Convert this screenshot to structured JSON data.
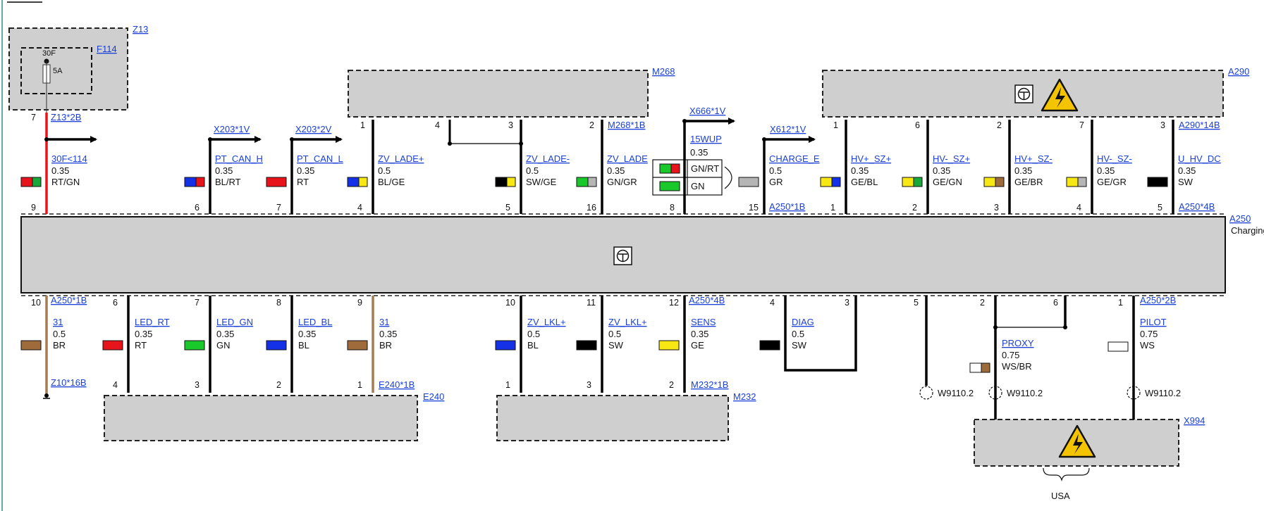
{
  "z13": {
    "id": "Z13",
    "fuse_id": "F114",
    "fuse_terminal": "30F",
    "fuse_rating": "5A",
    "conn": "Z13*2B",
    "pin": "7"
  },
  "m268": {
    "id": "M268",
    "conn": "M268*1B"
  },
  "a290": {
    "id": "A290",
    "conn": "A290*14B"
  },
  "a250": {
    "id": "A250",
    "desc": "Charging",
    "conn_top_left": "A250*1B",
    "conn_top_right": "A250*4B",
    "conn_bot_left": "A250*1B",
    "conn_bot_mid": "A250*4B",
    "conn_bot_right": "A250*2B"
  },
  "e240": {
    "id": "E240",
    "conn": "E240*1B"
  },
  "m232": {
    "id": "M232",
    "conn": "M232*1B"
  },
  "x994": {
    "id": "X994",
    "note": "USA"
  },
  "z10": {
    "conn": "Z10*16B"
  },
  "arrows": {
    "x203_1v": "X203*1V",
    "x203_2v": "X203*2V",
    "x666_1v": "X666*1V",
    "x612_1v": "X612*1V"
  },
  "wup": {
    "label": "15WUP",
    "size": "0.35",
    "wire_a": "GN/RT",
    "wire_b": "GN",
    "pin_bottom": "8"
  },
  "top_wires": [
    {
      "id": "w30f",
      "top_pin": "",
      "bot_pin": "9",
      "name": "30F<114",
      "size": "0.35",
      "color": "RT/GN",
      "c1": "#e8141b",
      "c2": "#19a83a"
    },
    {
      "id": "wcanh",
      "top_pin": "",
      "bot_pin": "6",
      "name": "PT_CAN_H",
      "size": "0.35",
      "color": "BL/RT",
      "c1": "#1531e8",
      "c2": "#e8141b"
    },
    {
      "id": "wcanl",
      "top_pin": "",
      "bot_pin": "7",
      "name": "PT_CAN_L",
      "size": "0.35",
      "color": "RT",
      "c1": "#e8141b",
      "c2": ""
    },
    {
      "id": "wlade1",
      "top_pin": "1",
      "bot_pin": "4",
      "name": "ZV_LADE+",
      "size": "0.5",
      "color": "BL/GE",
      "c1": "#1531e8",
      "c2": "#f7e813"
    },
    {
      "id": "wlade2",
      "top_pin": "3",
      "bot_pin": "5",
      "name": "ZV_LADE-",
      "size": "0.5",
      "color": "SW/GE",
      "c1": "#000000",
      "c2": "#f7e813"
    },
    {
      "id": "wlade3",
      "top_pin": "2",
      "bot_pin": "16",
      "name": "ZV_LADE",
      "size": "0.35",
      "color": "GN/GR",
      "c1": "#19c82a",
      "c2": "#b5b5b5"
    },
    {
      "id": "wcharge",
      "top_pin": "",
      "bot_pin": "15",
      "name": "CHARGE_E",
      "size": "0.5",
      "color": "GR",
      "c1": "#b5b5b5",
      "c2": ""
    },
    {
      "id": "whv1",
      "top_pin": "1",
      "bot_pin": "1",
      "name": "HV+_SZ+",
      "size": "0.35",
      "color": "GE/BL",
      "c1": "#f7e813",
      "c2": "#1531e8"
    },
    {
      "id": "whv2",
      "top_pin": "6",
      "bot_pin": "2",
      "name": "HV-_SZ+",
      "size": "0.35",
      "color": "GE/GN",
      "c1": "#f7e813",
      "c2": "#19a83a"
    },
    {
      "id": "whv3",
      "top_pin": "2",
      "bot_pin": "3",
      "name": "HV+_SZ-",
      "size": "0.35",
      "color": "GE/BR",
      "c1": "#f7e813",
      "c2": "#a06b3a"
    },
    {
      "id": "whv4",
      "top_pin": "7",
      "bot_pin": "4",
      "name": "HV-_SZ-",
      "size": "0.35",
      "color": "GE/GR",
      "c1": "#f7e813",
      "c2": "#b5b5b5"
    },
    {
      "id": "whvdc",
      "top_pin": "3",
      "bot_pin": "5",
      "name": "U_HV_DC",
      "size": "0.35",
      "color": "SW",
      "c1": "#000000",
      "c2": ""
    }
  ],
  "m268_pin4": "4",
  "bottom_wires": [
    {
      "id": "b31a",
      "top_pin": "10",
      "bot_pin": "",
      "name": "31",
      "size": "0.5",
      "color": "BR",
      "c1": "#a06b3a"
    },
    {
      "id": "bledrt",
      "top_pin": "6",
      "bot_pin": "4",
      "name": "LED_RT",
      "size": "0.35",
      "color": "RT",
      "c1": "#e8141b"
    },
    {
      "id": "bledgn",
      "top_pin": "7",
      "bot_pin": "3",
      "name": "LED_GN",
      "size": "0.35",
      "color": "GN",
      "c1": "#19c82a"
    },
    {
      "id": "bledbl",
      "top_pin": "8",
      "bot_pin": "2",
      "name": "LED_BL",
      "size": "0.35",
      "color": "BL",
      "c1": "#1531e8"
    },
    {
      "id": "b31b",
      "top_pin": "9",
      "bot_pin": "1",
      "name": "31",
      "size": "0.35",
      "color": "BR",
      "c1": "#a06b3a"
    },
    {
      "id": "blkl1",
      "top_pin": "10",
      "bot_pin": "1",
      "name": "ZV_LKL+",
      "size": "0.5",
      "color": "BL",
      "c1": "#1531e8"
    },
    {
      "id": "blkl2",
      "top_pin": "11",
      "bot_pin": "3",
      "name": "ZV_LKL+",
      "size": "0.5",
      "color": "SW",
      "c1": "#000000"
    },
    {
      "id": "bsens",
      "top_pin": "12",
      "bot_pin": "2",
      "name": "SENS",
      "size": "0.35",
      "color": "GE",
      "c1": "#f7e813"
    },
    {
      "id": "bdiag",
      "top_pin": "4",
      "bot_pin": "",
      "name": "DIAG",
      "size": "0.5",
      "color": "SW",
      "c1": "#000000"
    },
    {
      "id": "bproxy",
      "top_pin": "2",
      "bot_pin": "",
      "name": "PROXY",
      "size": "0.75",
      "color": "WS/BR",
      "c1": "#ffffff",
      "c2": "#a06b3a"
    },
    {
      "id": "bpilot",
      "top_pin": "1",
      "bot_pin": "",
      "name": "PILOT",
      "size": "0.75",
      "color": "WS",
      "c1": "#ffffff"
    }
  ],
  "diag_pin2": "3",
  "proxy_pin2": "6",
  "w9110_pin": "5",
  "grounds": [
    "W9110.2",
    "W9110.2",
    "W9110.2"
  ]
}
